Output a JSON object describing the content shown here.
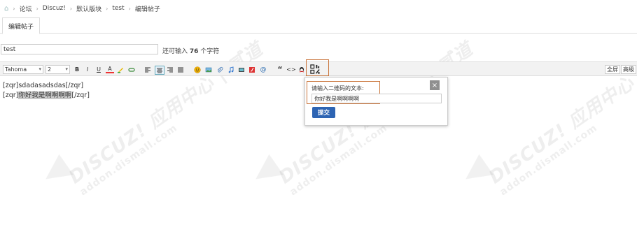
{
  "breadcrumb": {
    "items": [
      "论坛",
      "Discuz!",
      "默认版块",
      "test",
      "编辑帖子"
    ]
  },
  "tab": {
    "label": "编辑帖子"
  },
  "subject": {
    "value": "test",
    "hint_prefix": "还可输入",
    "hint_count": "76",
    "hint_suffix": "个字符"
  },
  "toolbar": {
    "font_family": "Tahoma",
    "font_size": "2",
    "bold": "B",
    "italic": "I",
    "underline": "U",
    "font_color": "A",
    "quote": "“",
    "code": "<>",
    "fullscreen": "全屏",
    "advanced": "高级"
  },
  "content": {
    "line1": "[zqr]sdadasadsdas[/zqr]",
    "line2_open": "[zqr]",
    "line2_text": "你好我是啊啊啊啊",
    "line2_close": "[/zqr]"
  },
  "popup": {
    "label": "请输入二维码的文本:",
    "input_value": "你好我是啊啊啊啊",
    "submit": "提交",
    "close": "×"
  },
  "watermark": {
    "brand": "DISCUZ!",
    "cn": "应用中心",
    "url": "addon.dismall.com",
    "note": "贰道"
  },
  "colors": {
    "accent_orange": "#c9743a",
    "submit_blue": "#2d64b3"
  }
}
